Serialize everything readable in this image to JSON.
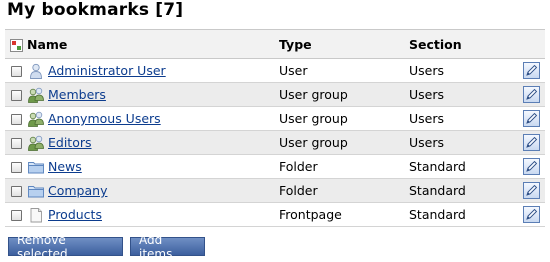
{
  "page": {
    "title": "My bookmarks [7]"
  },
  "table": {
    "headers": {
      "name": "Name",
      "type": "Type",
      "section": "Section"
    },
    "rows": [
      {
        "name": "Administrator User",
        "type": "User",
        "section": "Users",
        "icon": "user-icon"
      },
      {
        "name": "Members",
        "type": "User group",
        "section": "Users",
        "icon": "user-group-icon"
      },
      {
        "name": "Anonymous Users",
        "type": "User group",
        "section": "Users",
        "icon": "user-group-icon"
      },
      {
        "name": "Editors",
        "type": "User group",
        "section": "Users",
        "icon": "user-group-icon"
      },
      {
        "name": "News",
        "type": "Folder",
        "section": "Standard",
        "icon": "folder-icon"
      },
      {
        "name": "Company",
        "type": "Folder",
        "section": "Standard",
        "icon": "folder-icon"
      },
      {
        "name": "Products",
        "type": "Frontpage",
        "section": "Standard",
        "icon": "frontpage-icon"
      }
    ]
  },
  "actions": {
    "remove_label": "Remove selected",
    "add_label": "Add items"
  },
  "colors": {
    "link": "#0c3c8e",
    "button": "#4a6aa8",
    "row_alt": "#ececec"
  }
}
